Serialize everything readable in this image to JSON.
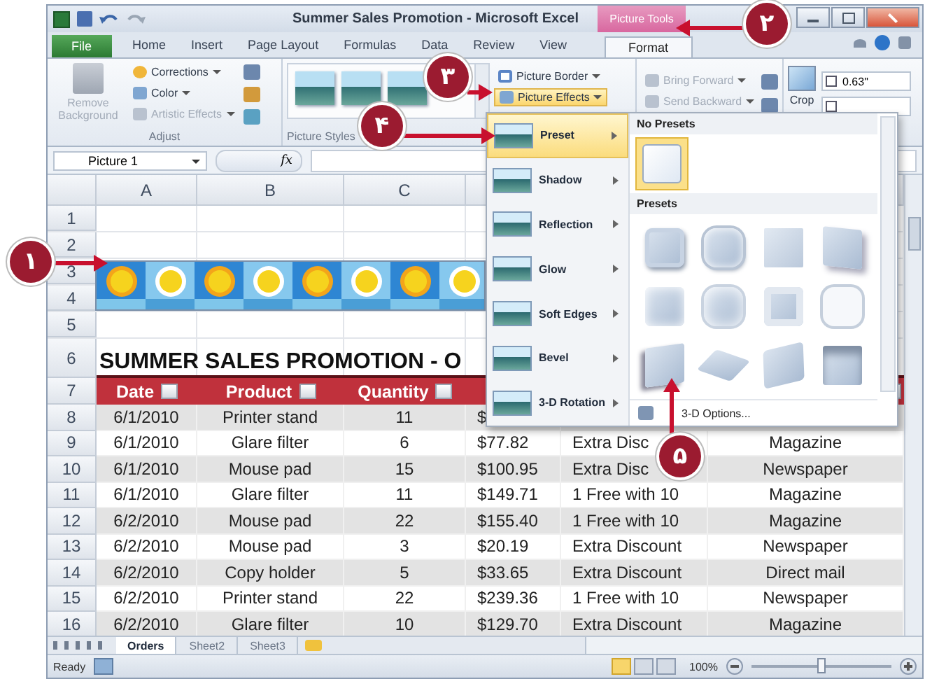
{
  "window": {
    "title": "Summer Sales Promotion - Microsoft Excel",
    "contextual_group": "Picture Tools"
  },
  "ribbon_tabs": [
    {
      "label": "File",
      "kind": "file",
      "selected": false
    },
    {
      "label": "Home",
      "kind": "tab",
      "selected": false
    },
    {
      "label": "Insert",
      "kind": "tab",
      "selected": false
    },
    {
      "label": "Page Layout",
      "kind": "tab",
      "selected": false
    },
    {
      "label": "Formulas",
      "kind": "tab",
      "selected": false
    },
    {
      "label": "Data",
      "kind": "tab",
      "selected": false
    },
    {
      "label": "Review",
      "kind": "tab",
      "selected": false
    },
    {
      "label": "View",
      "kind": "tab",
      "selected": false
    },
    {
      "label": "Format",
      "kind": "tab",
      "selected": true
    }
  ],
  "ribbon": {
    "adjust": {
      "label": "Adjust",
      "large_button": {
        "label": "Remove Background",
        "disabled": true
      },
      "buttons": [
        {
          "label": "Corrections",
          "disabled": false
        },
        {
          "label": "Color",
          "disabled": false
        },
        {
          "label": "Artistic Effects",
          "disabled": true
        }
      ]
    },
    "picture_styles": {
      "label": "Picture Styles",
      "buttons": [
        {
          "label": "Picture Border",
          "selected": false
        },
        {
          "label": "Picture Effects",
          "selected": true
        }
      ]
    },
    "arrange": {
      "buttons": [
        {
          "label": "Bring Forward",
          "disabled": true
        },
        {
          "label": "Send Backward",
          "disabled": true
        }
      ]
    },
    "size": {
      "height": "0.63\"",
      "crop": "Crop"
    }
  },
  "formula_bar": {
    "name_box": "Picture 1",
    "function_button": "fx"
  },
  "sheet": {
    "columns": [
      "A",
      "B",
      "C"
    ],
    "rows": [
      {
        "number": "1",
        "kind": "blank"
      },
      {
        "number": "2",
        "kind": "blank"
      },
      {
        "number": "3",
        "kind": "blank"
      },
      {
        "number": "4",
        "kind": "blank"
      },
      {
        "number": "5",
        "kind": "blank"
      },
      {
        "number": "6",
        "kind": "title",
        "text": "SUMMER SALES PROMOTION - O"
      },
      {
        "number": "7",
        "kind": "header",
        "cells": [
          "Date",
          "Product",
          "Quantity"
        ]
      },
      {
        "number": "8",
        "kind": "data",
        "cells": [
          "6/1/2010",
          "Printer stand",
          "11",
          "$"
        ]
      },
      {
        "number": "9",
        "kind": "data",
        "cells": [
          "6/1/2010",
          "Glare filter",
          "6",
          "$77.82",
          "Extra Disc",
          "Magazine"
        ]
      },
      {
        "number": "10",
        "kind": "data",
        "cells": [
          "6/1/2010",
          "Mouse pad",
          "15",
          "$100.95",
          "Extra Disc",
          "Newspaper"
        ]
      },
      {
        "number": "11",
        "kind": "data",
        "cells": [
          "6/1/2010",
          "Glare filter",
          "11",
          "$149.71",
          "1 Free with 10",
          "Magazine"
        ]
      },
      {
        "number": "12",
        "kind": "data",
        "cells": [
          "6/2/2010",
          "Mouse pad",
          "22",
          "$155.40",
          "1 Free with 10",
          "Magazine"
        ]
      },
      {
        "number": "13",
        "kind": "data",
        "cells": [
          "6/2/2010",
          "Mouse pad",
          "3",
          "$20.19",
          "Extra Discount",
          "Newspaper"
        ]
      },
      {
        "number": "14",
        "kind": "data",
        "cells": [
          "6/2/2010",
          "Copy holder",
          "5",
          "$33.65",
          "Extra Discount",
          "Direct mail"
        ]
      },
      {
        "number": "15",
        "kind": "data",
        "cells": [
          "6/2/2010",
          "Printer stand",
          "22",
          "$239.36",
          "1 Free with 10",
          "Newspaper"
        ]
      },
      {
        "number": "16",
        "kind": "data",
        "cells": [
          "6/2/2010",
          "Glare filter",
          "10",
          "$129.70",
          "Extra Discount",
          "Magazine"
        ]
      }
    ]
  },
  "sheet_tabs": [
    {
      "label": "Orders",
      "selected": true
    },
    {
      "label": "Sheet2",
      "selected": false
    },
    {
      "label": "Sheet3",
      "selected": false
    }
  ],
  "status_bar": {
    "status": "Ready",
    "zoom": {
      "label": "100%",
      "level": 0.5
    }
  },
  "effects_menu": {
    "items": [
      {
        "label": "Preset",
        "selected": true
      },
      {
        "label": "Shadow",
        "selected": false
      },
      {
        "label": "Reflection",
        "selected": false
      },
      {
        "label": "Glow",
        "selected": false
      },
      {
        "label": "Soft Edges",
        "selected": false
      },
      {
        "label": "Bevel",
        "selected": false
      },
      {
        "label": "3-D Rotation",
        "selected": false
      }
    ],
    "submenu": {
      "no_presets_heading": "No Presets",
      "no_preset": {
        "selected": true
      },
      "presets_heading": "Presets",
      "presets": [
        {
          "selected": false
        },
        {
          "selected": false
        },
        {
          "selected": false
        },
        {
          "selected": false
        },
        {
          "selected": false
        },
        {
          "selected": false
        },
        {
          "selected": false
        },
        {
          "selected": false
        },
        {
          "selected": false
        },
        {
          "selected": false
        },
        {
          "selected": false
        },
        {
          "selected": false
        }
      ],
      "options_link": "3-D Options..."
    }
  },
  "callouts": [
    "۱",
    "۲",
    "۳",
    "۴",
    "۵"
  ]
}
